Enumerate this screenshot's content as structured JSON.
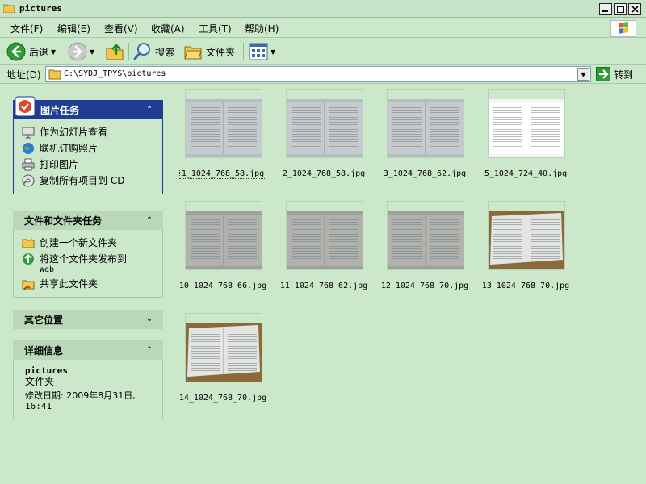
{
  "window": {
    "title": "pictures"
  },
  "menu": {
    "file": "文件(F)",
    "edit": "编辑(E)",
    "view": "查看(V)",
    "favorites": "收藏(A)",
    "tools": "工具(T)",
    "help": "帮助(H)"
  },
  "toolbar": {
    "back": "后退",
    "search": "搜索",
    "folders": "文件夹"
  },
  "address": {
    "label": "地址(D)",
    "path": "C:\\SYDJ_TPYS\\pictures",
    "go": "转到"
  },
  "picture_tasks": {
    "title": "图片任务",
    "items": [
      "作为幻灯片查看",
      "联机订购照片",
      "打印图片",
      "复制所有项目到 CD"
    ]
  },
  "folder_tasks": {
    "title": "文件和文件夹任务",
    "items": [
      "创建一个新文件夹",
      "将这个文件夹发布到",
      "共享此文件夹"
    ],
    "publish_sub": "Web"
  },
  "other_places": {
    "title": "其它位置"
  },
  "details": {
    "title": "详细信息",
    "name": "pictures",
    "type": "文件夹",
    "modified": "修改日期: 2009年8月31日,",
    "modified_time": "16:41"
  },
  "files": [
    "1_1024_768_58.jpg",
    "2_1024_768_58.jpg",
    "3_1024_768_62.jpg",
    "5_1024_724_40.jpg",
    "10_1024_768_66.jpg",
    "11_1024_768_62.jpg",
    "12_1024_768_70.jpg",
    "13_1024_768_70.jpg",
    "14_1024_768_70.jpg"
  ]
}
